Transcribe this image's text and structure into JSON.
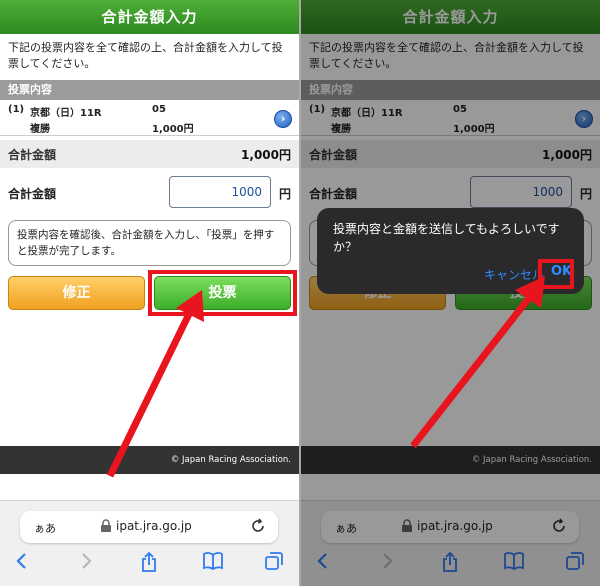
{
  "header": {
    "title": "合計金額入力"
  },
  "instruction": "下記の投票内容を全て確認の上、合計金額を入力して投票してください。",
  "section": {
    "title": "投票内容"
  },
  "bet": {
    "num": "(1)",
    "venue": "京都（日）11R",
    "type": "複勝",
    "combo": "05",
    "amount": "1,000円"
  },
  "total": {
    "label": "合計金額",
    "value": "1,000円"
  },
  "input": {
    "label": "合計金額",
    "value": "1000",
    "unit": "円"
  },
  "notice": "投票内容を確認後、合計金額を入力し、「投票」を押すと投票が完了します。",
  "buttons": {
    "fix": "修正",
    "vote": "投票"
  },
  "footer": {
    "copyright": "© Japan Racing Association."
  },
  "browser": {
    "aa": "ぁあ",
    "domain": "ipat.jra.go.jp"
  },
  "dialog": {
    "message": "投票内容と金額を送信してもよろしいですか？",
    "cancel": "キャンセル",
    "ok": "OK"
  },
  "colors": {
    "header_green": "#3a9a2a",
    "highlight_red": "#e8141e",
    "link_blue": "#2f8cff"
  },
  "icons": [
    "chevron-right-icon",
    "lock-icon",
    "reload-icon",
    "back-icon",
    "forward-icon",
    "share-icon",
    "bookmarks-icon",
    "tabs-icon"
  ]
}
